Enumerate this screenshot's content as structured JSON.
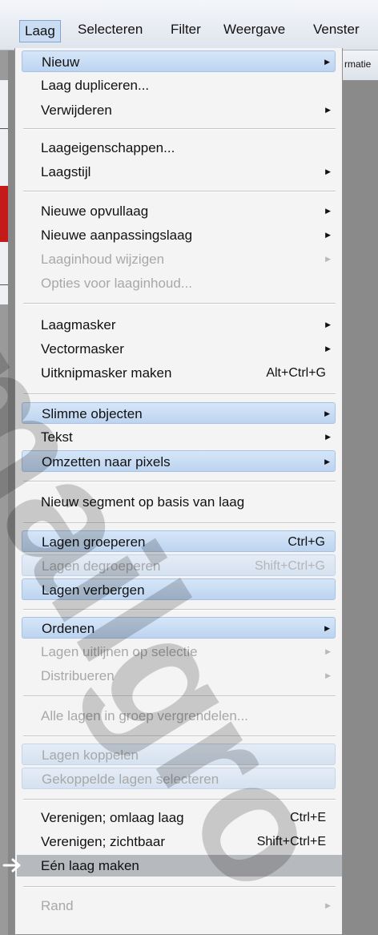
{
  "menubar": {
    "items": [
      "Laag",
      "Selecteren",
      "Filter",
      "Weergave",
      "Venster"
    ]
  },
  "options_bar_fragment": "rmatie",
  "menu": {
    "items": [
      {
        "label": "Nieuw",
        "submenu": true,
        "state": "highlighted"
      },
      {
        "label": "Laag dupliceren..."
      },
      {
        "label": "Verwijderen",
        "submenu": true
      },
      {
        "label": "Laageigenschappen..."
      },
      {
        "label": "Laagstijl",
        "submenu": true
      },
      {
        "label": "Nieuwe opvullaag",
        "submenu": true
      },
      {
        "label": "Nieuwe aanpassingslaag",
        "submenu": true
      },
      {
        "label": "Laaginhoud wijzigen",
        "submenu": true,
        "state": "disabled"
      },
      {
        "label": "Opties voor laaginhoud...",
        "state": "disabled"
      },
      {
        "label": "Laagmasker",
        "submenu": true
      },
      {
        "label": "Vectormasker",
        "submenu": true
      },
      {
        "label": "Uitknipmasker maken",
        "shortcut": "Alt+Ctrl+G"
      },
      {
        "label": "Slimme objecten",
        "submenu": true,
        "state": "highlighted"
      },
      {
        "label": "Tekst",
        "submenu": true
      },
      {
        "label": "Omzetten naar pixels",
        "submenu": true,
        "state": "highlighted"
      },
      {
        "label": "Nieuw segment op basis van laag"
      },
      {
        "label": "Lagen groeperen",
        "shortcut": "Ctrl+G",
        "state": "highlighted"
      },
      {
        "label": "Lagen degroeperen",
        "shortcut": "Shift+Ctrl+G",
        "state": "highlighted-disabled"
      },
      {
        "label": "Lagen verbergen",
        "state": "highlighted"
      },
      {
        "label": "Ordenen",
        "submenu": true,
        "state": "highlighted"
      },
      {
        "label": "Lagen uitlijnen op selectie",
        "submenu": true,
        "state": "disabled"
      },
      {
        "label": "Distribueren",
        "submenu": true,
        "state": "disabled"
      },
      {
        "label": "Alle lagen in groep vergrendelen...",
        "state": "disabled"
      },
      {
        "label": "Lagen koppelen",
        "state": "highlighted-disabled"
      },
      {
        "label": "Gekoppelde lagen selecteren",
        "state": "highlighted-disabled"
      },
      {
        "label": "Verenigen; omlaag laag",
        "shortcut": "Ctrl+E"
      },
      {
        "label": "Verenigen; zichtbaar",
        "shortcut": "Shift+Ctrl+E"
      },
      {
        "label": "Eén laag maken",
        "state": "selected"
      },
      {
        "label": "Rand",
        "submenu": true,
        "state": "disabled"
      }
    ]
  },
  "watermark": "mailgro",
  "colors": {
    "highlight": "#bcd4f0",
    "selected": "#b6b9bd",
    "disabled_text": "#a8a8a8"
  }
}
